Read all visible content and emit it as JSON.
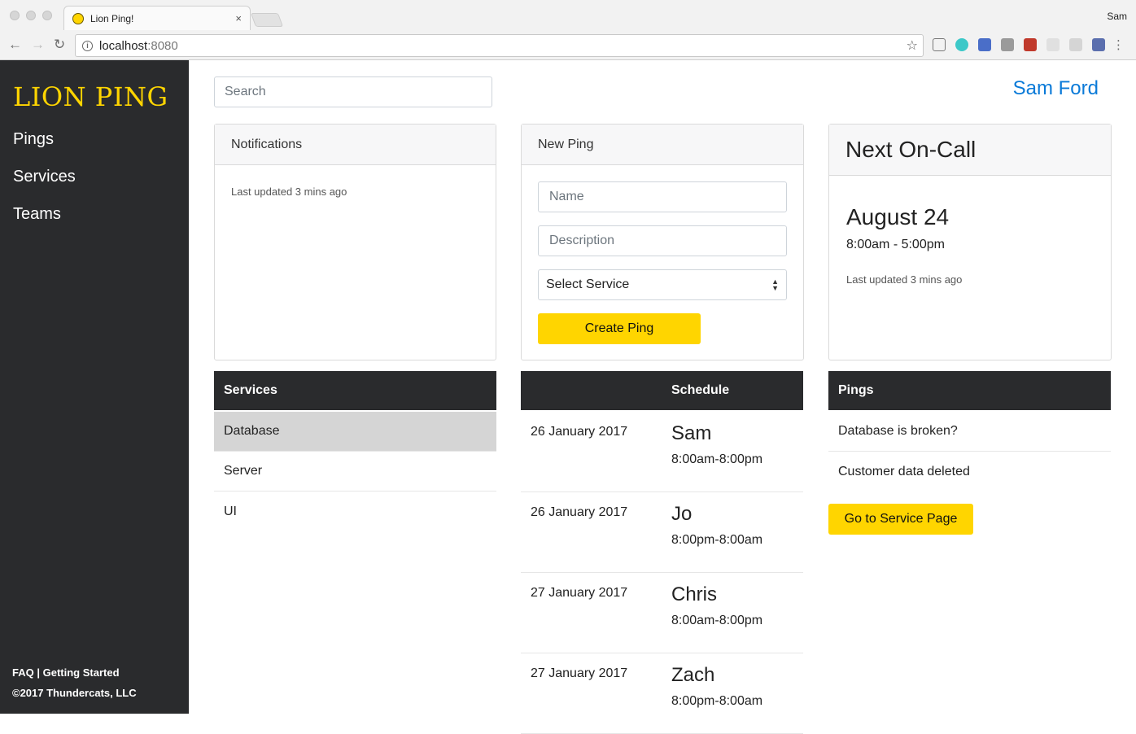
{
  "browser": {
    "tab_title": "Lion Ping!",
    "tab_close": "×",
    "profile_name": "Sam",
    "url_host": "localhost",
    "url_port": ":8080",
    "icons": [
      "back-icon",
      "forward-icon",
      "reload-icon",
      "info-icon",
      "star-icon",
      "cast-icon",
      "menu-icon"
    ]
  },
  "sidebar": {
    "brand": "LION PING",
    "nav": [
      {
        "label": "Pings"
      },
      {
        "label": "Services"
      },
      {
        "label": "Teams"
      }
    ],
    "footer_faq": "FAQ",
    "footer_separator": "|",
    "footer_getting_started": "Getting Started",
    "copyright": "©2017 Thundercats, LLC"
  },
  "header": {
    "search_placeholder": "Search",
    "user_name": "Sam Ford"
  },
  "notifications": {
    "title": "Notifications",
    "updated": "Last updated 3 mins ago"
  },
  "new_ping": {
    "title": "New Ping",
    "name_placeholder": "Name",
    "description_placeholder": "Description",
    "service_select": "Select Service",
    "create_label": "Create Ping"
  },
  "on_call": {
    "title": "Next On-Call",
    "date": "August 24",
    "time": "8:00am - 5:00pm",
    "updated": "Last updated 3 mins ago"
  },
  "services": {
    "header": "Services",
    "items": [
      {
        "label": "Database",
        "active": true
      },
      {
        "label": "Server",
        "active": false
      },
      {
        "label": "UI",
        "active": false
      }
    ]
  },
  "schedule": {
    "header": "Schedule",
    "rows": [
      {
        "date": "26 January 2017",
        "name": "Sam",
        "hours": "8:00am-8:00pm"
      },
      {
        "date": "26 January 2017",
        "name": "Jo",
        "hours": "8:00pm-8:00am"
      },
      {
        "date": "27 January 2017",
        "name": "Chris",
        "hours": "8:00am-8:00pm"
      },
      {
        "date": "27 January 2017",
        "name": "Zach",
        "hours": "8:00pm-8:00am"
      }
    ]
  },
  "pings": {
    "header": "Pings",
    "items": [
      {
        "label": "Database is broken?"
      },
      {
        "label": "Customer data deleted"
      }
    ],
    "service_page_label": "Go to Service Page"
  },
  "colors": {
    "brand_yellow": "#ffd500",
    "sidebar_bg": "#2a2b2d",
    "link_blue": "#0a7ad8"
  }
}
